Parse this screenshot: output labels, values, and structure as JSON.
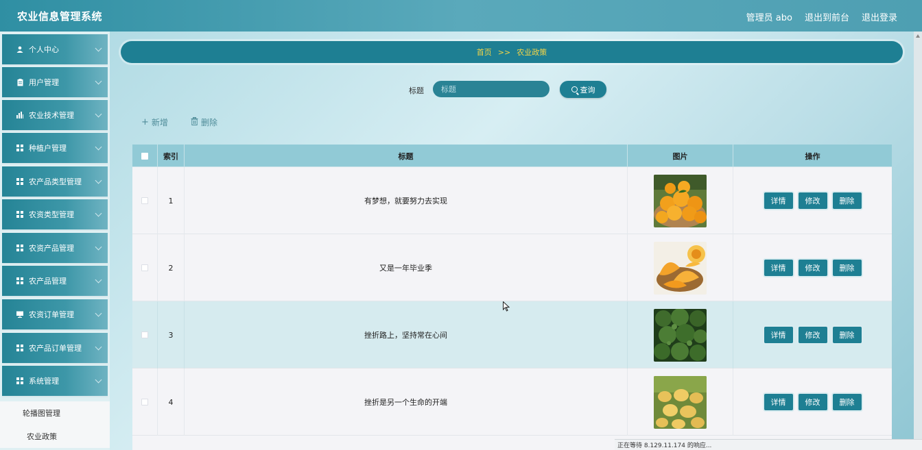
{
  "app": {
    "title": "农业信息管理系统",
    "user_label": "管理员 abo",
    "to_front_label": "退出到前台",
    "logout_label": "退出登录"
  },
  "sidebar": {
    "items": [
      {
        "label": "个人中心",
        "icon": "user-icon"
      },
      {
        "label": "用户管理",
        "icon": "clipboard-icon"
      },
      {
        "label": "农业技术管理",
        "icon": "bar-chart-icon"
      },
      {
        "label": "种植户管理",
        "icon": "grid-icon"
      },
      {
        "label": "农产品类型管理",
        "icon": "grid-icon"
      },
      {
        "label": "农资类型管理",
        "icon": "grid-icon"
      },
      {
        "label": "农资产品管理",
        "icon": "grid-icon"
      },
      {
        "label": "农产品管理",
        "icon": "grid-icon"
      },
      {
        "label": "农资订单管理",
        "icon": "monitor-icon"
      },
      {
        "label": "农产品订单管理",
        "icon": "grid-icon"
      },
      {
        "label": "系统管理",
        "icon": "grid-icon"
      }
    ],
    "submenu": [
      {
        "label": "轮播图管理"
      },
      {
        "label": "农业政策"
      }
    ]
  },
  "breadcrumb": {
    "home": "首页",
    "separator": ">>",
    "current": "农业政策"
  },
  "search": {
    "label": "标题",
    "placeholder": "标题",
    "button_label": "查询"
  },
  "actions": {
    "add_label": "新增",
    "delete_label": "删除"
  },
  "table": {
    "columns": [
      "索引",
      "标题",
      "图片",
      "操作"
    ],
    "op_labels": [
      "详情",
      "修改",
      "删除"
    ],
    "rows": [
      {
        "index": "1",
        "title": "有梦想，就要努力去实现",
        "image": "oranges"
      },
      {
        "index": "2",
        "title": "又是一年毕业季",
        "image": "melon"
      },
      {
        "index": "3",
        "title": "挫折路上，坚持常在心间",
        "image": "broccoli"
      },
      {
        "index": "4",
        "title": "挫折是另一个生命的开端",
        "image": "potatoes"
      }
    ]
  },
  "status_bar": {
    "text": "正在等待 8.129.11.174 的响应..."
  },
  "colors": {
    "primary": "#1e7f93",
    "breadcrumb_text": "#f5d547",
    "table_header": "#91cad6",
    "row_highlight": "#d6ebef"
  }
}
